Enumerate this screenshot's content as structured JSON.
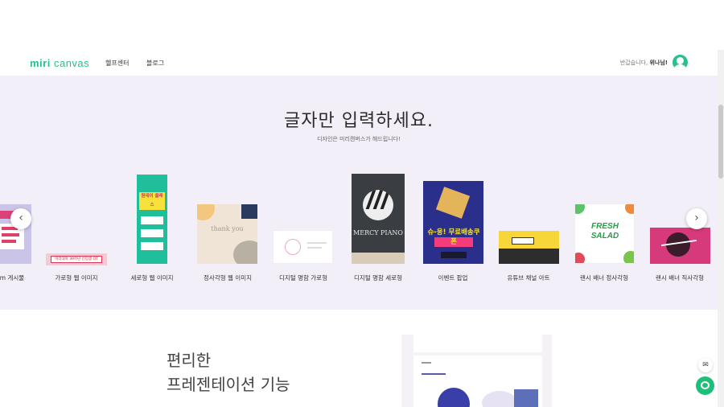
{
  "header": {
    "logo_part1": "miri",
    "logo_part2": "canvas",
    "nav": [
      "헬프센터",
      "블로그"
    ],
    "welcome_prefix": "반갑습니다,",
    "welcome_name": "위나님!"
  },
  "hero": {
    "title": "글자만 입력하세요.",
    "subtitle": "디자인은 미리캔버스가 해드립니다!"
  },
  "templates": [
    {
      "label": "m 게시물"
    },
    {
      "label": "가로형 웹 이미지",
      "text": "미리대학 39학년 신입생 OT"
    },
    {
      "label": "세로형 웹 이미지",
      "text": "원데이 클래스"
    },
    {
      "label": "정사각형 웹 이미지",
      "text": "thank you"
    },
    {
      "label": "디지털 명함 가로형"
    },
    {
      "label": "디지털 명함 세로형",
      "text": "MERCY PIANO"
    },
    {
      "label": "이벤트 팝업",
      "text": "슈-웅! 무료배송쿠폰"
    },
    {
      "label": "유튜브 채널 아트"
    },
    {
      "label": "랜시 배너 정사각형",
      "text": "FRESH SALAD"
    },
    {
      "label": "랜시 배너 직사각형"
    }
  ],
  "feature": {
    "line1": "편리한",
    "line2": "프레젠테이션 기능"
  },
  "colors": {
    "brand": "#28c08a",
    "hero_bg": "#f3eff8"
  },
  "icons": [
    "chevron-left-icon",
    "chevron-right-icon",
    "mail-icon",
    "chat-icon",
    "user-avatar-icon"
  ]
}
